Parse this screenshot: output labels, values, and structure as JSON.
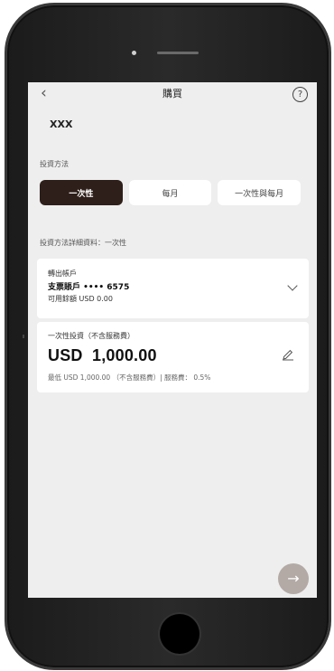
{
  "header": {
    "title": "購買",
    "back_icon": "‹",
    "help_icon": "?"
  },
  "fund": {
    "name": "XXX"
  },
  "investment_method": {
    "label": "投資方法",
    "tabs": [
      {
        "label": "一次性",
        "active": true
      },
      {
        "label": "每月",
        "active": false
      },
      {
        "label": "一次性與每月",
        "active": false
      }
    ]
  },
  "details": {
    "label": "投資方法詳細資料：一次性"
  },
  "account_card": {
    "heading": "轉出帳戶",
    "account": "支票賬戶 •••• 6575",
    "balance": "可用餘額 USD 0.00"
  },
  "amount_card": {
    "heading": "一次性投資（不含服務費）",
    "amount": "USD  1,000.00",
    "note": "最低 USD 1,000.00 （不含服務費）| 服務費： 0.5%"
  },
  "next_button": {
    "icon": "→"
  }
}
